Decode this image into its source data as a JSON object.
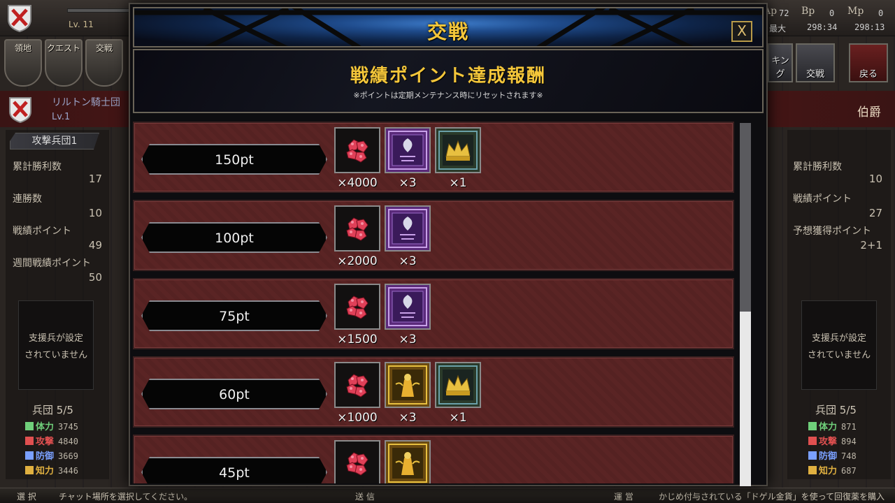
{
  "topbar": {
    "level": "Lv. 11",
    "stats": [
      {
        "label": "Ap",
        "value": "72"
      },
      {
        "label": "Bp",
        "value": "0"
      },
      {
        "label": "Mp",
        "value": "0"
      }
    ],
    "max_label": "最大",
    "timer_bp": "298:34",
    "timer_mp": "298:13"
  },
  "nav": {
    "territory": "領地",
    "quest": "クエスト",
    "battle_left": "交戦",
    "ranking": "キング",
    "battle": "交戦",
    "back": "戻る"
  },
  "guild": {
    "name": "リルトン騎士団",
    "level": "Lv.1",
    "rank": "伯爵"
  },
  "left_panel": {
    "header": "攻撃兵団1",
    "rows": [
      {
        "label": "累計勝利数",
        "value": "17"
      },
      {
        "label": "連勝数",
        "value": "10"
      },
      {
        "label": "戦績ポイント",
        "value": "49"
      },
      {
        "label": "週間戦績ポイント",
        "value": "50"
      }
    ],
    "support_line1": "支援兵が設定",
    "support_line2": "されていません",
    "unit_label": "兵団",
    "unit_count": "5/5",
    "stats": [
      {
        "label": "体力",
        "value": "3745",
        "color": "#6fcf7a"
      },
      {
        "label": "攻撃",
        "value": "4840",
        "color": "#e05050"
      },
      {
        "label": "防御",
        "value": "3669",
        "color": "#7aa0ff"
      },
      {
        "label": "知力",
        "value": "3446",
        "color": "#e0b040"
      }
    ]
  },
  "right_panel": {
    "rows": [
      {
        "label": "累計勝利数",
        "value": "10"
      },
      {
        "label": "戦績ポイント",
        "value": "27"
      },
      {
        "label": "予想獲得ポイント",
        "value": "2+1"
      }
    ],
    "support_line1": "支援兵が設定",
    "support_line2": "されていません",
    "unit_label": "兵団",
    "unit_count": "5/5",
    "stats": [
      {
        "label": "体力",
        "value": "871",
        "color": "#6fcf7a"
      },
      {
        "label": "攻撃",
        "value": "894",
        "color": "#e05050"
      },
      {
        "label": "防御",
        "value": "748",
        "color": "#7aa0ff"
      },
      {
        "label": "知力",
        "value": "687",
        "color": "#e0b040"
      }
    ]
  },
  "modal": {
    "title": "交戦",
    "close": "X",
    "subtitle": "戦績ポイント達成報酬",
    "note": "※ポイントは定期メンテナンス時にリセットされます※",
    "scroll_fraction": 0.52,
    "rewards": [
      {
        "points": "150pt",
        "items": [
          {
            "icon": "ruby-gem-icon",
            "qty": "×4000"
          },
          {
            "icon": "purple-card-icon",
            "qty": "×3"
          },
          {
            "icon": "crown-card-icon",
            "qty": "×1"
          }
        ]
      },
      {
        "points": "100pt",
        "items": [
          {
            "icon": "ruby-gem-icon",
            "qty": "×2000"
          },
          {
            "icon": "purple-card-icon",
            "qty": "×3"
          }
        ]
      },
      {
        "points": "75pt",
        "items": [
          {
            "icon": "ruby-gem-icon",
            "qty": "×1500"
          },
          {
            "icon": "purple-card-icon",
            "qty": "×3"
          }
        ]
      },
      {
        "points": "60pt",
        "items": [
          {
            "icon": "ruby-gem-icon",
            "qty": "×1000"
          },
          {
            "icon": "gold-card-icon",
            "qty": "×3"
          },
          {
            "icon": "crown-card-icon",
            "qty": "×1"
          }
        ]
      },
      {
        "points": "45pt",
        "items": [
          {
            "icon": "ruby-gem-icon",
            "qty": ""
          },
          {
            "icon": "gold-card-icon",
            "qty": ""
          }
        ]
      }
    ]
  },
  "bottombar": {
    "select": "選 択",
    "chat_placeholder": "チャット場所を選択してください。",
    "send": "送 信",
    "operation": "運 営",
    "ticker": "かじめ付与されている「ドゲル金貨」を使って回復薬を購入"
  }
}
